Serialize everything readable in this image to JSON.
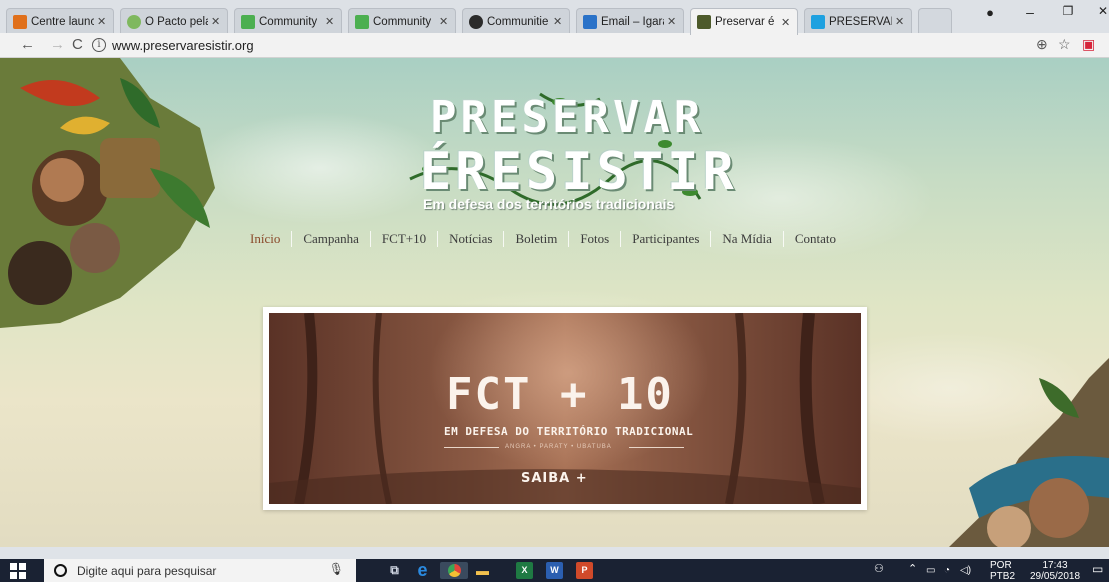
{
  "browser": {
    "tabs": [
      {
        "title": "Centre launc",
        "favicon_color": "#e0701b",
        "active": false
      },
      {
        "title": "O Pacto pela",
        "favicon_color": "#7fb85e",
        "active": false
      },
      {
        "title": "Community",
        "favicon_color": "#4caf50",
        "active": false
      },
      {
        "title": "Community",
        "favicon_color": "#4caf50",
        "active": false
      },
      {
        "title": "Communitie",
        "favicon_color": "#2b2b2b",
        "active": false
      },
      {
        "title": "Email – Igara",
        "favicon_color": "#2a72c8",
        "active": false
      },
      {
        "title": "Preservar é R",
        "favicon_color": "#4d5a2b",
        "active": true
      },
      {
        "title": "PRESERVAR",
        "favicon_color": "#1ea1e0",
        "active": false
      }
    ],
    "url": "www.preservaresistir.org"
  },
  "site": {
    "logo_line1": "PRESERVAR",
    "logo_line2": "ÉRESISTIR",
    "tagline": "Em defesa dos territórios tradicionais",
    "nav": [
      "Início",
      "Campanha",
      "FCT+10",
      "Notícias",
      "Boletim",
      "Fotos",
      "Participantes",
      "Na Mídia",
      "Contato"
    ],
    "banner": {
      "title": "FCT + 10",
      "subtitle": "EM DEFESA DO TERRITÓRIO TRADICIONAL",
      "places": "ANGRA • PARATY • UBATUBA",
      "cta": "SAIBA +"
    }
  },
  "taskbar": {
    "search_placeholder": "Digite aqui para pesquisar",
    "lang": "POR",
    "layout": "PTB2",
    "time": "17:43",
    "date": "29/05/2018"
  },
  "colors": {
    "nav_active": "#8a4a2a",
    "taskbar_bg": "#1a2233"
  }
}
